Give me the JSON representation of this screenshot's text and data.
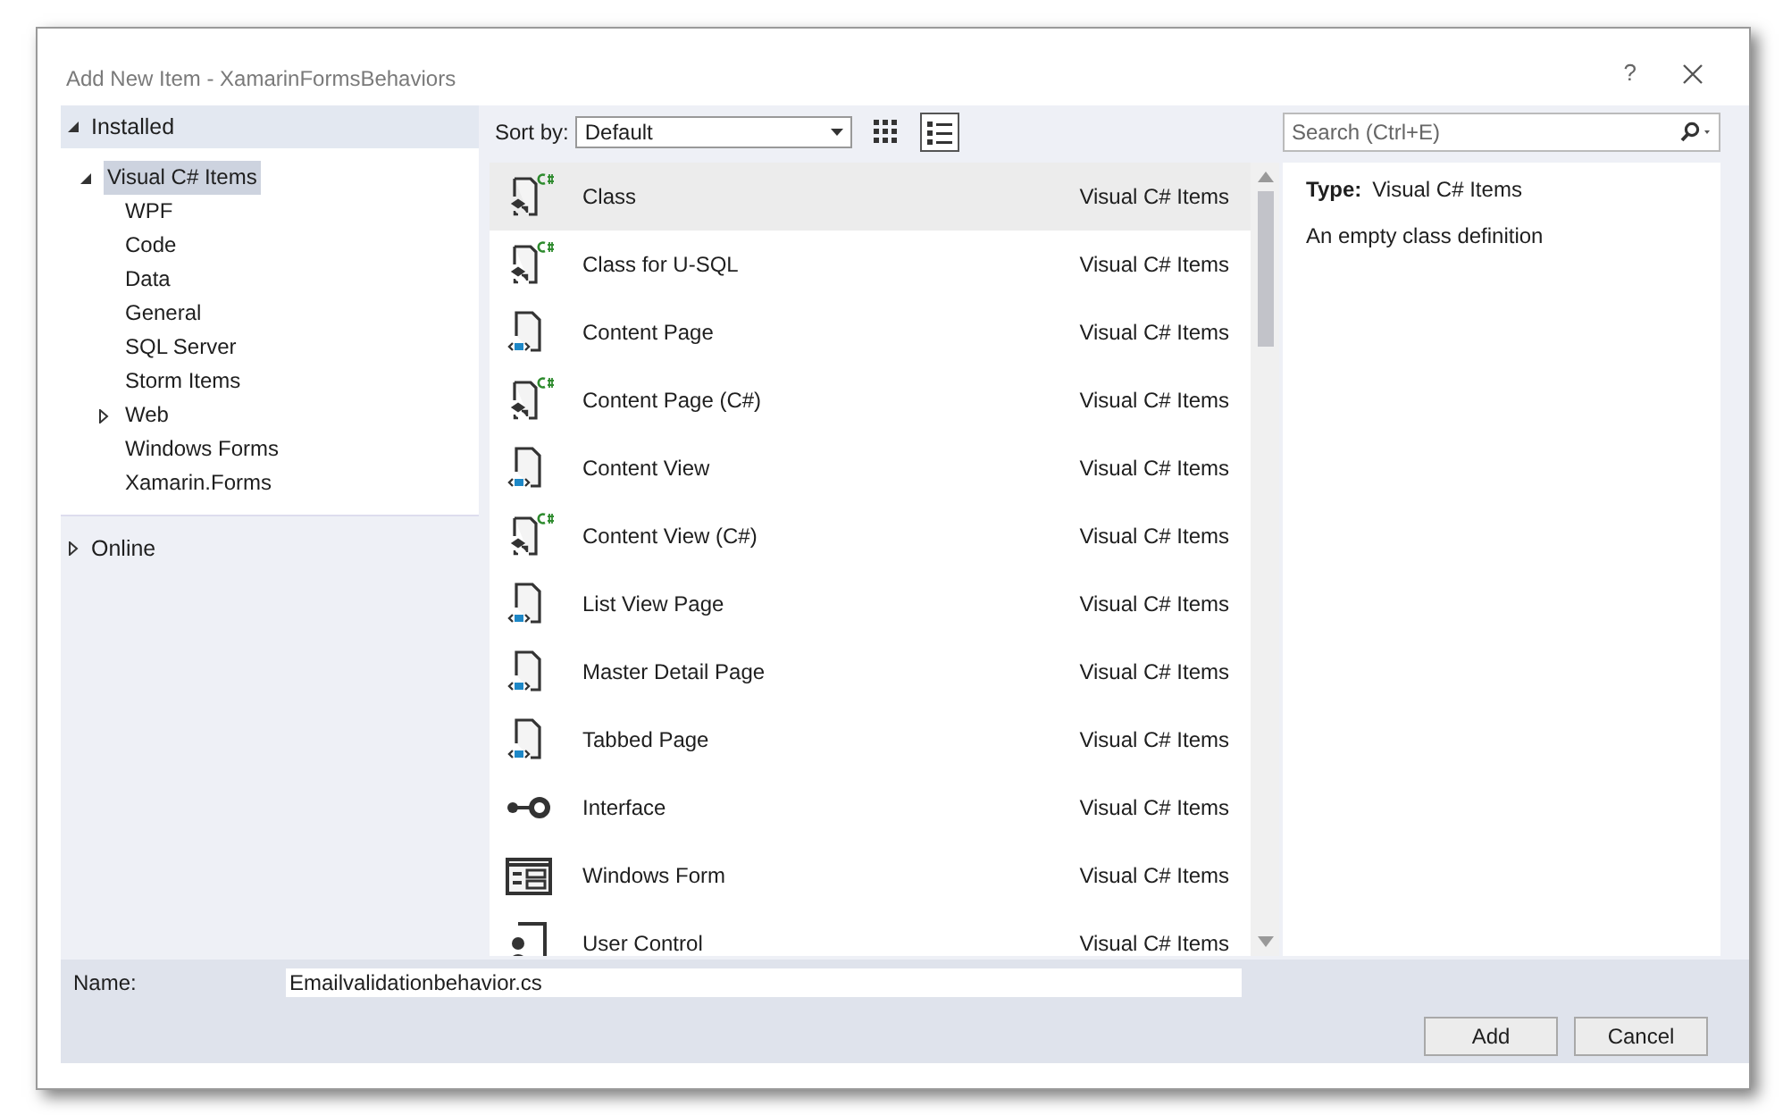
{
  "window": {
    "title": "Add New Item - XamarinFormsBehaviors",
    "help": "?"
  },
  "sidebar": {
    "items": [
      {
        "label": "Installed",
        "expanded": true,
        "children": [
          {
            "label": "Visual C# Items",
            "expanded": true,
            "selected": true,
            "children": [
              {
                "label": "WPF",
                "selected": false
              },
              {
                "label": "Code",
                "selected": false
              },
              {
                "label": "Data",
                "selected": false
              },
              {
                "label": "General",
                "selected": false
              },
              {
                "label": "SQL Server",
                "selected": false
              },
              {
                "label": "Storm Items",
                "selected": false
              },
              {
                "label": "Web",
                "expanded": false,
                "selected": false
              },
              {
                "label": "Windows Forms",
                "selected": false
              },
              {
                "label": "Xamarin.Forms",
                "selected": false
              }
            ]
          }
        ]
      },
      {
        "label": "Online",
        "expanded": false
      }
    ]
  },
  "toolbar": {
    "sort_label": "Sort by:",
    "sort_value": "Default",
    "views": [
      {
        "kind": "small-icons",
        "selected": false
      },
      {
        "kind": "list",
        "selected": true
      }
    ]
  },
  "search": {
    "placeholder": "Search (Ctrl+E)"
  },
  "templates": [
    {
      "name": "Class",
      "category": "Visual C# Items",
      "kind": "code",
      "selected": true
    },
    {
      "name": "Class for U-SQL",
      "category": "Visual C# Items",
      "kind": "code",
      "selected": false
    },
    {
      "name": "Content Page",
      "category": "Visual C# Items",
      "kind": "markup",
      "selected": false
    },
    {
      "name": "Content Page (C#)",
      "category": "Visual C# Items",
      "kind": "code",
      "selected": false
    },
    {
      "name": "Content View",
      "category": "Visual C# Items",
      "kind": "markup",
      "selected": false
    },
    {
      "name": "Content View (C#)",
      "category": "Visual C# Items",
      "kind": "code",
      "selected": false
    },
    {
      "name": "List View Page",
      "category": "Visual C# Items",
      "kind": "markup",
      "selected": false
    },
    {
      "name": "Master Detail Page",
      "category": "Visual C# Items",
      "kind": "markup",
      "selected": false
    },
    {
      "name": "Tabbed Page",
      "category": "Visual C# Items",
      "kind": "markup",
      "selected": false
    },
    {
      "name": "Interface",
      "category": "Visual C# Items",
      "kind": "interface",
      "selected": false
    },
    {
      "name": "Windows Form",
      "category": "Visual C# Items",
      "kind": "form",
      "selected": false
    },
    {
      "name": "User Control",
      "category": "Visual C# Items",
      "kind": "control",
      "selected": false
    }
  ],
  "details": {
    "type_label": "Type:",
    "type_value": "Visual C# Items",
    "description": "An empty class definition"
  },
  "name_field": {
    "label": "Name:",
    "value": "Emailvalidationbehavior.cs"
  },
  "buttons": [
    "Add",
    "Cancel"
  ]
}
